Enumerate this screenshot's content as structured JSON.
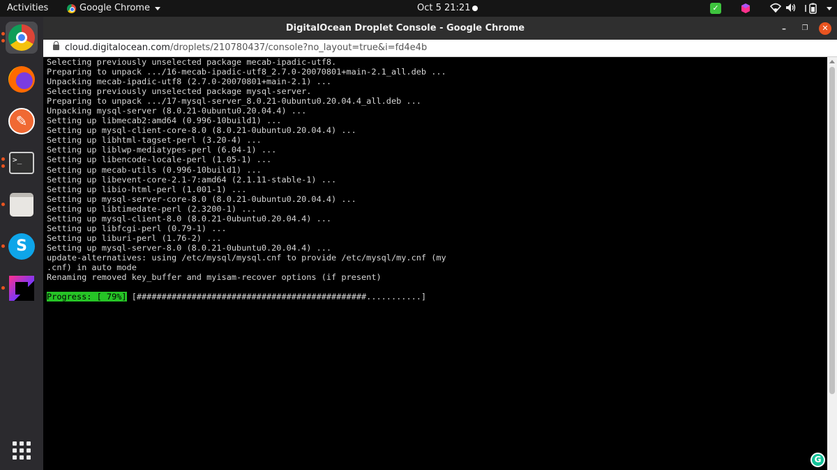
{
  "topbar": {
    "activities": "Activities",
    "app_name": "Google Chrome",
    "clock": "Oct 5  21:21"
  },
  "window": {
    "title": "DigitalOcean Droplet Console - Google Chrome",
    "url_host": "cloud.digitalocean.com",
    "url_path": "/droplets/210780437/console?no_layout=true&i=fd4e4b"
  },
  "dock": {
    "apps": [
      "chrome-icon",
      "firefox-icon",
      "postman-icon",
      "terminal-icon",
      "files-icon",
      "skype-icon",
      "jetbrains-toolbox-icon"
    ]
  },
  "console": {
    "lines": [
      "Selecting previously unselected package mecab-ipadic-utf8.",
      "Preparing to unpack .../16-mecab-ipadic-utf8_2.7.0-20070801+main-2.1_all.deb ...",
      "Unpacking mecab-ipadic-utf8 (2.7.0-20070801+main-2.1) ...",
      "Selecting previously unselected package mysql-server.",
      "Preparing to unpack .../17-mysql-server_8.0.21-0ubuntu0.20.04.4_all.deb ...",
      "Unpacking mysql-server (8.0.21-0ubuntu0.20.04.4) ...",
      "Setting up libmecab2:amd64 (0.996-10build1) ...",
      "Setting up mysql-client-core-8.0 (8.0.21-0ubuntu0.20.04.4) ...",
      "Setting up libhtml-tagset-perl (3.20-4) ...",
      "Setting up liblwp-mediatypes-perl (6.04-1) ...",
      "Setting up libencode-locale-perl (1.05-1) ...",
      "Setting up mecab-utils (0.996-10build1) ...",
      "Setting up libevent-core-2.1-7:amd64 (2.1.11-stable-1) ...",
      "Setting up libio-html-perl (1.001-1) ...",
      "Setting up mysql-server-core-8.0 (8.0.21-0ubuntu0.20.04.4) ...",
      "Setting up libtimedate-perl (2.3200-1) ...",
      "Setting up mysql-client-8.0 (8.0.21-0ubuntu0.20.04.4) ...",
      "Setting up libfcgi-perl (0.79-1) ...",
      "Setting up liburi-perl (1.76-2) ...",
      "Setting up mysql-server-8.0 (8.0.21-0ubuntu0.20.04.4) ...",
      "update-alternatives: using /etc/mysql/mysql.cnf to provide /etc/mysql/my.cnf (my",
      ".cnf) in auto mode",
      "Renaming removed key_buffer and myisam-recover options (if present)"
    ],
    "progress_label": "Progress: [ 79%]",
    "progress_bar": " [##############################################...........]",
    "progress_percent": 79
  },
  "colors": {
    "progress_green": "#26c426",
    "ubuntu_orange": "#e95420",
    "console_bg": "#000000"
  }
}
